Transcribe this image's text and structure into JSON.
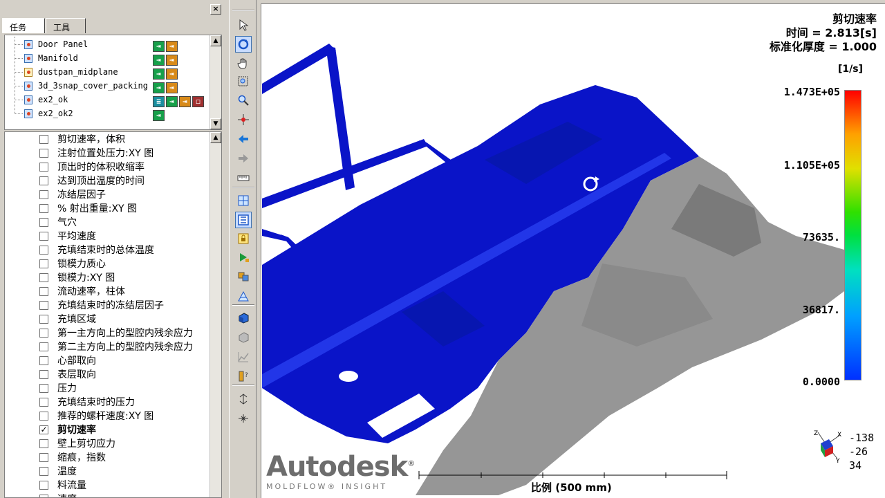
{
  "left_panel": {
    "tabs": [
      "任务",
      "工具"
    ],
    "close_label": "×",
    "studies": [
      {
        "name": "Door Panel",
        "badges": [
          "g",
          "o"
        ]
      },
      {
        "name": "Manifold",
        "badges": [
          "g",
          "o"
        ]
      },
      {
        "name": "dustpan_midplane",
        "badges": [
          "g",
          "o"
        ]
      },
      {
        "name": "3d_3snap_cover_packing",
        "badges": [
          "g",
          "o"
        ]
      },
      {
        "name": "ex2_ok",
        "badges": [
          "t",
          "g",
          "o",
          "r"
        ]
      },
      {
        "name": "ex2_ok2",
        "badges": [
          "g"
        ]
      }
    ],
    "results": [
      {
        "label": "剪切速率，体积",
        "checked": false
      },
      {
        "label": "注射位置处压力:XY 图",
        "checked": false
      },
      {
        "label": "顶出时的体积收缩率",
        "checked": false
      },
      {
        "label": "达到顶出温度的时间",
        "checked": false
      },
      {
        "label": "冻结层因子",
        "checked": false
      },
      {
        "label": "% 射出重量:XY 图",
        "checked": false
      },
      {
        "label": "气穴",
        "checked": false
      },
      {
        "label": "平均速度",
        "checked": false
      },
      {
        "label": "充填结束时的总体温度",
        "checked": false
      },
      {
        "label": "锁模力质心",
        "checked": false
      },
      {
        "label": "锁模力:XY 图",
        "checked": false
      },
      {
        "label": "流动速率，柱体",
        "checked": false
      },
      {
        "label": "充填结束时的冻结层因子",
        "checked": false
      },
      {
        "label": "充填区域",
        "checked": false
      },
      {
        "label": "第一主方向上的型腔内残余应力",
        "checked": false
      },
      {
        "label": "第二主方向上的型腔内残余应力",
        "checked": false
      },
      {
        "label": "心部取向",
        "checked": false
      },
      {
        "label": "表层取向",
        "checked": false
      },
      {
        "label": "压力",
        "checked": false
      },
      {
        "label": "充填结束时的压力",
        "checked": false
      },
      {
        "label": "推荐的螺杆速度:XY 图",
        "checked": false
      },
      {
        "label": "剪切速率",
        "checked": true
      },
      {
        "label": "壁上剪切应力",
        "checked": false
      },
      {
        "label": "缩痕，指数",
        "checked": false
      },
      {
        "label": "温度",
        "checked": false
      },
      {
        "label": "料流量",
        "checked": false
      },
      {
        "label": "速度",
        "checked": false
      }
    ]
  },
  "toolbar": {
    "icons": [
      "select-arrow-icon",
      "rotate-icon",
      "pan-hand-icon",
      "zoom-box-icon",
      "zoom-icon",
      "center-icon",
      "back-arrow-icon",
      "forward-arrow-icon",
      "measure-icon",
      "grid-icon",
      "fit-icon",
      "lock-icon",
      "play-icon",
      "layers-icon",
      "probe-icon",
      "cube-icon",
      "rotate-cube-icon",
      "chart-icon",
      "legend-icon",
      "expand-icon",
      "collapse-icon"
    ]
  },
  "viewport": {
    "result_title": "剪切速率",
    "time_line": "时间 = 2.813[s]",
    "thickness_line": "标准化厚度 = 1.000",
    "units": "[1/s]",
    "scale_labels": [
      "1.473E+05",
      "1.105E+05",
      "73635.",
      "36817.",
      "0.0000"
    ],
    "triad_values": [
      "-138",
      "-26",
      "34"
    ],
    "triad_axes": [
      "Z",
      "X",
      "Y"
    ],
    "scale_text": "比例 (500 mm)",
    "brand": "Autodesk",
    "brand_sub": "MOLDFLOW® INSIGHT",
    "colors": {
      "part_blue": "#0a14c8",
      "part_gray": "#969696",
      "highlight": "#2236e8"
    }
  }
}
